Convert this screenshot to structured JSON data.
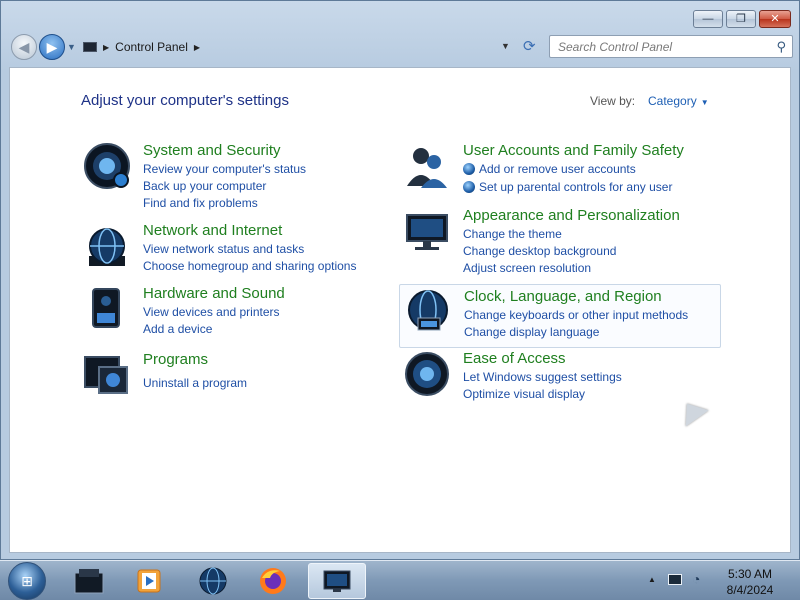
{
  "window": {
    "caption_buttons": {
      "minimize": "—",
      "maximize": "❐",
      "close": "✕"
    }
  },
  "nav": {
    "breadcrumb": [
      "Control Panel"
    ],
    "search_placeholder": "Search Control Panel"
  },
  "page": {
    "title": "Adjust your computer's settings",
    "view_by_label": "View by:",
    "view_by_value": "Category"
  },
  "categories": [
    {
      "title": "System and Security",
      "icon": "system-security-icon",
      "links": [
        "Review your computer's status",
        "Back up your computer",
        "Find and fix problems"
      ]
    },
    {
      "title": "Network and Internet",
      "icon": "network-globe-icon",
      "links": [
        "View network status and tasks",
        "Choose homegroup and sharing options"
      ]
    },
    {
      "title": "Hardware and Sound",
      "icon": "hardware-speaker-icon",
      "links": [
        "View devices and printers",
        "Add a device"
      ]
    },
    {
      "title": "Programs",
      "icon": "programs-icon",
      "links": [
        "Uninstall a program"
      ]
    },
    {
      "title": "User Accounts and Family Safety",
      "icon": "user-accounts-icon",
      "links": [
        "Add or remove user accounts",
        "Set up parental controls for any user"
      ]
    },
    {
      "title": "Appearance and Personalization",
      "icon": "monitor-icon",
      "links": [
        "Change the theme",
        "Change desktop background",
        "Adjust screen resolution"
      ]
    },
    {
      "title": "Clock, Language, and Region",
      "icon": "clock-globe-icon",
      "links": [
        "Change keyboards or other input methods",
        "Change display language"
      ]
    },
    {
      "title": "Ease of Access",
      "icon": "ease-of-access-icon",
      "links": [
        "Let Windows suggest settings",
        "Optimize visual display"
      ]
    }
  ],
  "taskbar": {
    "clock_time": "5:30 AM",
    "clock_date": "8/4/2024",
    "pinned": [
      "explorer-icon",
      "media-player-icon",
      "globe-icon",
      "firefox-icon",
      "control-panel-icon"
    ]
  },
  "colors": {
    "category_title": "#1f7f1f",
    "link": "#1f4fa5",
    "page_title": "#1e3287"
  }
}
